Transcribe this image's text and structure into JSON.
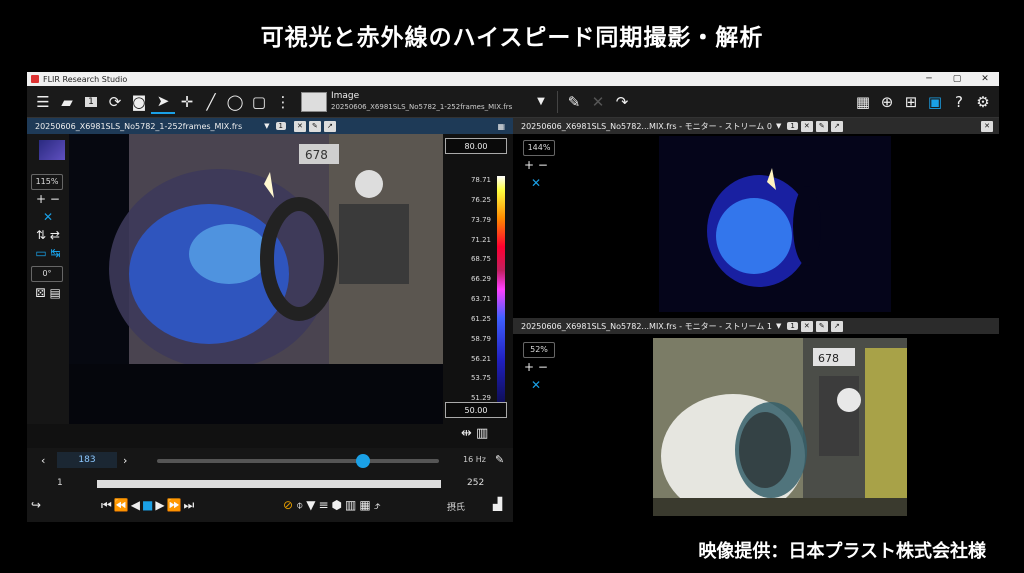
{
  "header": {
    "title": "可視光と赤外線のハイスピード同期撮影・解析",
    "credit": "映像提供：日本プラスト株式会社様"
  },
  "app": {
    "window_title": "FLIR Research Studio",
    "image_label": "Image",
    "image_file": "20250606_X6981SLS_No5782_1-252frames_MIX.frs"
  },
  "left_pane": {
    "tab": "20250606_X6981SLS_No5782_1-252frames_MIX.frs",
    "badge": "1",
    "zoom": "115%",
    "rotation": "0°",
    "scale_max": "80.00",
    "scale_min": "50.00",
    "scale_ticks": [
      "78.71",
      "76.25",
      "73.79",
      "71.21",
      "68.75",
      "66.29",
      "63.71",
      "61.25",
      "58.79",
      "56.21",
      "53.75",
      "51.29"
    ],
    "frame": "183",
    "rate": "16 Hz",
    "range_start": "1",
    "range_end": "252",
    "status_text": "摂氏",
    "playhead_position": 0.73
  },
  "right_top": {
    "tab": "20250606_X6981SLS_No5782...MIX.frs - モニター - ストリーム 0",
    "badge": "1",
    "zoom": "144%"
  },
  "right_bottom": {
    "tab": "20250606_X6981SLS_No5782...MIX.frs - モニター - ストリーム 1",
    "badge": "1",
    "zoom": "52%",
    "sign": "678"
  },
  "colors": {
    "accent": "#1aa0e6",
    "tab_active": "#1e3a57"
  }
}
